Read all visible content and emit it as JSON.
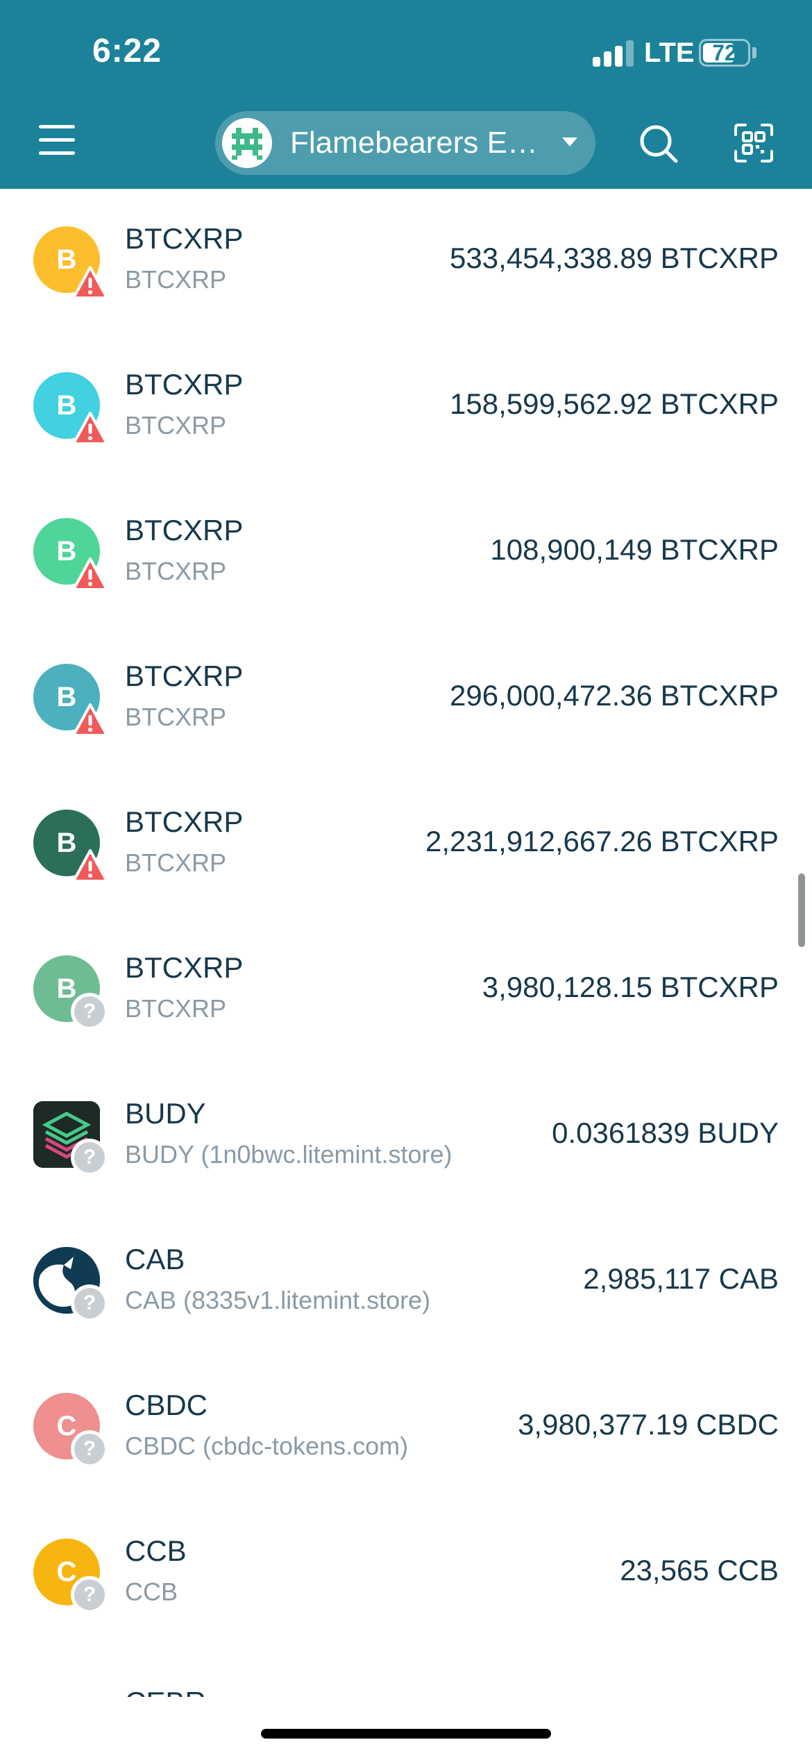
{
  "status_bar": {
    "time": "6:22",
    "network": "LTE",
    "battery_level": "72",
    "battery_fraction": 0.72,
    "signal_bars_active": 3,
    "signal_bars_total": 4
  },
  "header": {
    "wallet_name": "Flamebearers E…",
    "menu_icon": "hamburger-menu-icon",
    "search_icon": "search-icon",
    "scan_icon": "qr-scan-icon",
    "brand_color": "#1b8299"
  },
  "tokens": [
    {
      "name": "BTCXRP",
      "sub": "BTCXRP",
      "balance": "533,454,338.89 BTCXRP",
      "letter": "B",
      "color": "#fcbe2d",
      "badge": "warning"
    },
    {
      "name": "BTCXRP",
      "sub": "BTCXRP",
      "balance": "158,599,562.92 BTCXRP",
      "letter": "B",
      "color": "#41d1e0",
      "badge": "warning"
    },
    {
      "name": "BTCXRP",
      "sub": "BTCXRP",
      "balance": "108,900,149 BTCXRP",
      "letter": "B",
      "color": "#4fd597",
      "badge": "warning"
    },
    {
      "name": "BTCXRP",
      "sub": "BTCXRP",
      "balance": "296,000,472.36 BTCXRP",
      "letter": "B",
      "color": "#4cb0bf",
      "badge": "warning"
    },
    {
      "name": "BTCXRP",
      "sub": "BTCXRP",
      "balance": "2,231,912,667.26 BTCXRP",
      "letter": "B",
      "color": "#2c6f58",
      "badge": "warning"
    },
    {
      "name": "BTCXRP",
      "sub": "BTCXRP",
      "balance": "3,980,128.15 BTCXRP",
      "letter": "B",
      "color": "#6dbc92",
      "badge": "unknown"
    },
    {
      "name": "BUDY",
      "sub": "BUDY (1n0bwc.litemint.store)",
      "balance": "0.0361839 BUDY",
      "letter": "",
      "color": "#1e2a25",
      "badge": "unknown",
      "icon": "budy-logo-icon"
    },
    {
      "name": "CAB",
      "sub": "CAB (8335v1.litemint.store)",
      "balance": "2,985,117 CAB",
      "letter": "",
      "color": "#0f3b53",
      "badge": "unknown",
      "icon": "cab-logo-icon"
    },
    {
      "name": "CBDC",
      "sub": "CBDC (cbdc-tokens.com)",
      "balance": "3,980,377.19 CBDC",
      "letter": "C",
      "color": "#ef8f8f",
      "badge": "unknown"
    },
    {
      "name": "CCB",
      "sub": "CCB",
      "balance": "23,565 CCB",
      "letter": "C",
      "color": "#f7b50f",
      "badge": "unknown"
    }
  ],
  "partial_next_row": "CEBR",
  "badge_colors": {
    "warning": "#f15a5a",
    "unknown": "#c9ced3"
  }
}
